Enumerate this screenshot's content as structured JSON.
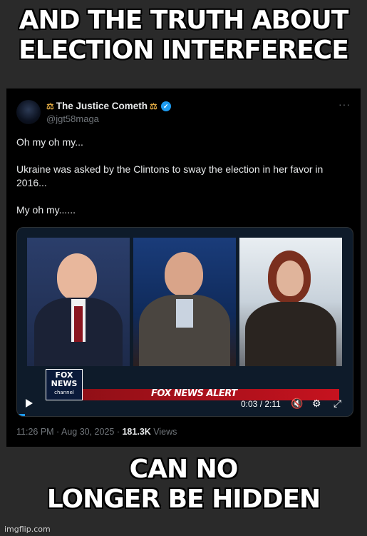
{
  "meme": {
    "top_line1": "AND THE TRUTH ABOUT",
    "top_line2": "ELECTION INTERFERECE",
    "bottom_line1": "CAN NO",
    "bottom_line2": "LONGER BE HIDDEN",
    "watermark": "imgflip.com"
  },
  "tweet": {
    "author_name": "The Justice Cometh",
    "author_prefix_icon": "scales-icon",
    "author_suffix_icon": "scales-icon",
    "verified_icon": "verified-badge-icon",
    "handle": "@jgt58maga",
    "more_icon_text": "···",
    "body": [
      "Oh my oh my...",
      "Ukraine was asked by the Clintons to sway the election in her favor in 2016...",
      "My oh my......"
    ],
    "timestamp": "11:26 PM · Aug 30, 2025 · ",
    "views_count": "181.3K",
    "views_label": " Views"
  },
  "video": {
    "fox_logo": "FOX NEWS",
    "fox_logo_sub": "channel",
    "ticker_text": "FOX NEWS ALERT",
    "time_display": "0:03 / 2:11",
    "play_icon": "play-icon",
    "mute_icon": "mute-icon",
    "settings_icon": "gear-icon",
    "fullscreen_icon": "expand-icon",
    "progress": 0.023
  },
  "colors": {
    "accent": "#1d9bf0",
    "text_primary": "#e7e9ea",
    "text_secondary": "#71767b",
    "fox_red": "#c6121f"
  }
}
